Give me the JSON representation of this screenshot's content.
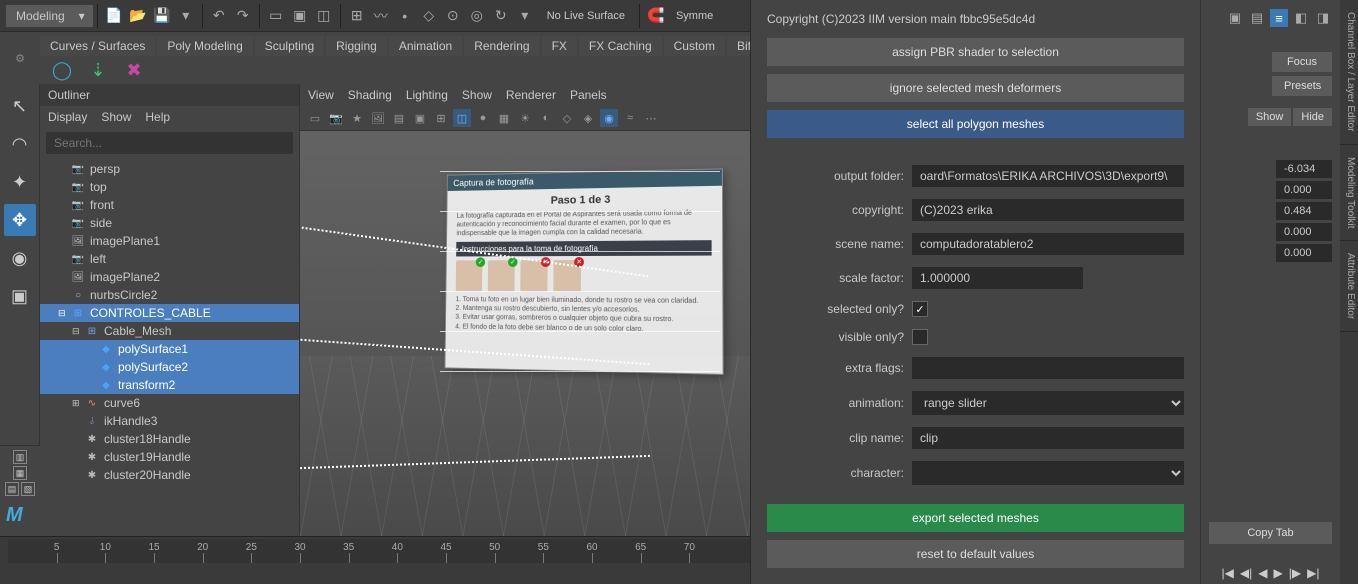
{
  "topbar": {
    "mode": "Modeling",
    "live": "No Live Surface",
    "sym": "Symme"
  },
  "shelf": {
    "tabs": [
      "Curves / Surfaces",
      "Poly Modeling",
      "Sculpting",
      "Rigging",
      "Animation",
      "Rendering",
      "FX",
      "FX Caching",
      "Custom",
      "Bif"
    ]
  },
  "outliner": {
    "title": "Outliner",
    "menus": [
      "Display",
      "Show",
      "Help"
    ],
    "search_ph": "Search...",
    "items": [
      {
        "ind": 1,
        "ic": "cam",
        "label": "persp"
      },
      {
        "ind": 1,
        "ic": "cam",
        "label": "top"
      },
      {
        "ind": 1,
        "ic": "cam",
        "label": "front"
      },
      {
        "ind": 1,
        "ic": "cam",
        "label": "side"
      },
      {
        "ind": 1,
        "ic": "img",
        "label": "imagePlane1"
      },
      {
        "ind": 1,
        "ic": "cam",
        "label": "left"
      },
      {
        "ind": 1,
        "ic": "img",
        "label": "imagePlane2"
      },
      {
        "ind": 1,
        "ic": "nurbs",
        "label": "nurbsCircle2"
      },
      {
        "ind": 1,
        "ic": "grp",
        "label": "CONTROLES_CABLE",
        "sel": true,
        "exp": "-"
      },
      {
        "ind": 2,
        "ic": "grp",
        "label": "Cable_Mesh",
        "exp": "-"
      },
      {
        "ind": 3,
        "ic": "poly",
        "label": "polySurface1",
        "sel": true
      },
      {
        "ind": 3,
        "ic": "poly",
        "label": "polySurface2",
        "sel": true
      },
      {
        "ind": 3,
        "ic": "poly",
        "label": "transform2",
        "sel": true
      },
      {
        "ind": 2,
        "ic": "crv",
        "label": "curve6",
        "exp": "+"
      },
      {
        "ind": 2,
        "ic": "ik",
        "label": "ikHandle3"
      },
      {
        "ind": 2,
        "ic": "clu",
        "label": "cluster18Handle"
      },
      {
        "ind": 2,
        "ic": "clu",
        "label": "cluster19Handle"
      },
      {
        "ind": 2,
        "ic": "clu",
        "label": "cluster20Handle"
      }
    ]
  },
  "viewport": {
    "menus": [
      "View",
      "Shading",
      "Lighting",
      "Show",
      "Renderer",
      "Panels"
    ],
    "laptop": {
      "hdr": "Captura de fotografía",
      "title": "Paso 1 de 3",
      "p1": "La fotografía capturada en el Portal de Aspirantes será usada como forma de autenticación y reconocimiento facial durante el examen, por lo que es indispensable que la imagen cumpla con la calidad necesaria.",
      "bar": "Instrucciones para la toma de fotografía",
      "list": "1. Toma tu foto en un lugar bien iluminado, donde tu rostro se vea con claridad.\n2. Mantenga su rostro descubierto, sin lentes y/o accesorios.\n3. Evitar usar gorras, sombreros o cualquier objeto que cubra su rostro.\n4. El fondo de la foto debe ser blanco o de un solo color claro."
    }
  },
  "panel": {
    "copyright": "Copyright (C)2023 IIM     version main fbbc95e5dc4d",
    "b1": "assign PBR shader to selection",
    "b2": "ignore selected mesh deformers",
    "b3": "select all polygon meshes",
    "fields": {
      "output_folder_lbl": "output folder:",
      "output_folder": "oard\\Formatos\\ERIKA ARCHIVOS\\3D\\export9\\",
      "copyright_lbl": "copyright:",
      "copyright": "(C)2023 erika",
      "scene_lbl": "scene name:",
      "scene": "computadoratablero2",
      "scale_lbl": "scale factor:",
      "scale": "1.000000",
      "selonly_lbl": "selected only?",
      "selonly": true,
      "visonly_lbl": "visible only?",
      "visonly": false,
      "extra_lbl": "extra flags:",
      "extra": "",
      "anim_lbl": "animation:",
      "anim": "range slider",
      "clip_lbl": "clip name:",
      "clip": "clip",
      "char_lbl": "character:",
      "char": ""
    },
    "b4": "export selected meshes",
    "b5": "reset to default values"
  },
  "rightpane": {
    "focus": "Focus",
    "presets": "Presets",
    "show": "Show",
    "hide": "Hide",
    "vals": [
      "-6.034",
      "0.000",
      "0.484",
      "0.000",
      "0.000"
    ],
    "copy": "Copy Tab",
    "tabs": [
      "Channel Box / Layer Editor",
      "Modeling Toolkit",
      "Attribute Editor"
    ]
  },
  "timeline": {
    "ticks": [
      5,
      10,
      15,
      20,
      25,
      30,
      35,
      40,
      45,
      50,
      55,
      60,
      65,
      70
    ]
  }
}
